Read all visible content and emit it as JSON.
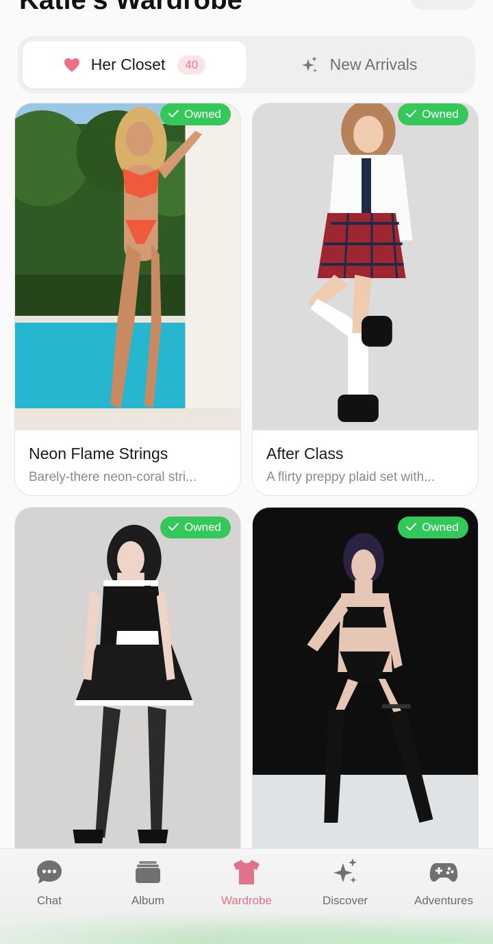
{
  "header": {
    "title": "Katie's Wardrobe"
  },
  "tabs": [
    {
      "label": "Her Closet",
      "icon": "heart-icon",
      "count": "40",
      "active": true
    },
    {
      "label": "New Arrivals",
      "icon": "sparkles-icon",
      "active": false
    }
  ],
  "outfits": [
    {
      "name": "Neon Flame Strings",
      "description": "Barely-there neon-coral stri...",
      "badge": "Owned"
    },
    {
      "name": "After Class",
      "description": "A flirty preppy plaid set with...",
      "badge": "Owned"
    },
    {
      "name": "",
      "description": "",
      "badge": "Owned"
    },
    {
      "name": "",
      "description": "",
      "badge": "Owned"
    }
  ],
  "nav": [
    {
      "label": "Chat",
      "icon": "chat-bubble-icon"
    },
    {
      "label": "Album",
      "icon": "album-icon"
    },
    {
      "label": "Wardrobe",
      "icon": "tshirt-icon",
      "active": true
    },
    {
      "label": "Discover",
      "icon": "sparkles-icon"
    },
    {
      "label": "Adventures",
      "icon": "gamepad-icon"
    }
  ],
  "colors": {
    "accent_pink": "#e2728a",
    "owned_green": "#34c759",
    "count_bg": "#fbe3e7"
  }
}
